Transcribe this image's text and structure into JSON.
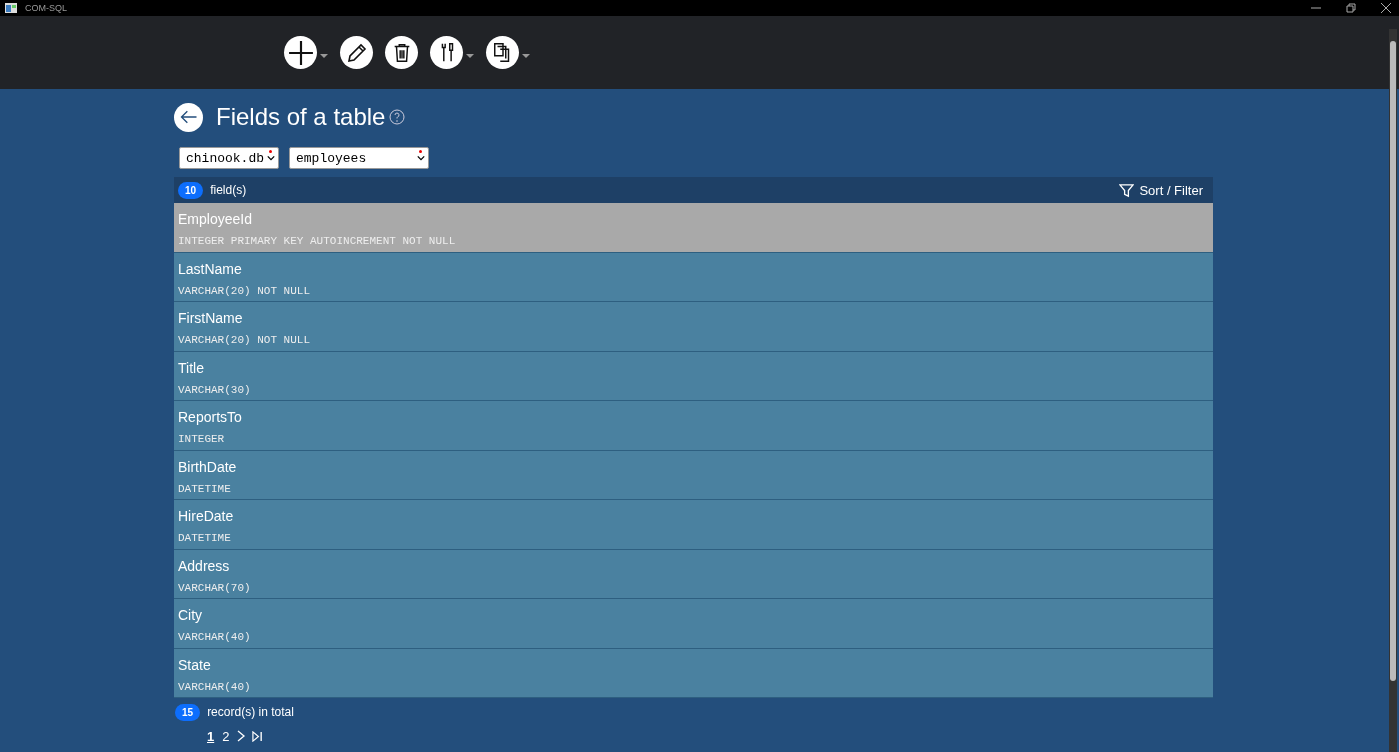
{
  "window": {
    "title": "COM-SQL"
  },
  "toolbar": [
    {
      "kind": "add",
      "dropdown": true
    },
    {
      "kind": "edit",
      "dropdown": false
    },
    {
      "kind": "delete",
      "dropdown": false
    },
    {
      "kind": "tools",
      "dropdown": true
    },
    {
      "kind": "copy",
      "dropdown": true
    }
  ],
  "page": {
    "title": "Fields of a table"
  },
  "selectors": [
    {
      "value": "chinook.db"
    },
    {
      "value": "employees"
    }
  ],
  "list_header": {
    "count": "10",
    "label": "field(s)",
    "sort_filter": "Sort / Filter"
  },
  "fields": [
    {
      "name": "EmployeeId",
      "type": "INTEGER PRIMARY KEY AUTOINCREMENT NOT NULL",
      "selected": true
    },
    {
      "name": "LastName",
      "type": "VARCHAR(20) NOT NULL",
      "selected": false
    },
    {
      "name": "FirstName",
      "type": "VARCHAR(20) NOT NULL",
      "selected": false
    },
    {
      "name": "Title",
      "type": "VARCHAR(30)",
      "selected": false
    },
    {
      "name": "ReportsTo",
      "type": "INTEGER",
      "selected": false
    },
    {
      "name": "BirthDate",
      "type": "DATETIME",
      "selected": false
    },
    {
      "name": "HireDate",
      "type": "DATETIME",
      "selected": false
    },
    {
      "name": "Address",
      "type": "VARCHAR(70)",
      "selected": false
    },
    {
      "name": "City",
      "type": "VARCHAR(40)",
      "selected": false
    },
    {
      "name": "State",
      "type": "VARCHAR(40)",
      "selected": false
    }
  ],
  "footer": {
    "count": "15",
    "label": "record(s) in total"
  },
  "pages": [
    {
      "label": "1",
      "selected": true
    },
    {
      "label": "2",
      "selected": false
    }
  ]
}
